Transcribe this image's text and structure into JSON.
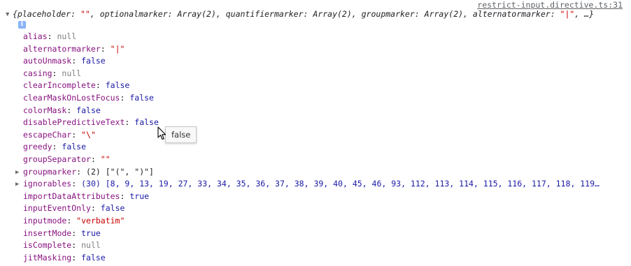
{
  "source_link": "restrict-input.directive.ts:31",
  "summary": {
    "open": "{",
    "items": [
      {
        "key": "placeholder",
        "value": "\"\"",
        "kind": "str"
      },
      {
        "key": "optionalmarker",
        "value": "Array(2)",
        "kind": "plain"
      },
      {
        "key": "quantifiermarker",
        "value": "Array(2)",
        "kind": "plain"
      },
      {
        "key": "groupmarker",
        "value": "Array(2)",
        "kind": "plain"
      },
      {
        "key": "alternatormarker",
        "value": "\"|\"",
        "kind": "str"
      }
    ],
    "tail": ", …}"
  },
  "info_icon": "i",
  "properties": [
    {
      "key": "alias",
      "value": "null",
      "kind": "null",
      "expandable": false
    },
    {
      "key": "alternatormarker",
      "value": "\"|\"",
      "kind": "str",
      "expandable": false
    },
    {
      "key": "autoUnmask",
      "value": "false",
      "kind": "bool",
      "expandable": false
    },
    {
      "key": "casing",
      "value": "null",
      "kind": "null",
      "expandable": false
    },
    {
      "key": "clearIncomplete",
      "value": "false",
      "kind": "bool",
      "expandable": false
    },
    {
      "key": "clearMaskOnLostFocus",
      "value": "false",
      "kind": "bool",
      "expandable": false
    },
    {
      "key": "colorMask",
      "value": "false",
      "kind": "bool",
      "expandable": false
    },
    {
      "key": "disablePredictiveText",
      "value": "false",
      "kind": "bool",
      "expandable": false
    },
    {
      "key": "escapeChar",
      "value": "\"\\\"",
      "kind": "str",
      "expandable": false
    },
    {
      "key": "greedy",
      "value": "false",
      "kind": "bool",
      "expandable": false
    },
    {
      "key": "groupSeparator",
      "value": "\"\"",
      "kind": "str",
      "expandable": false
    },
    {
      "key": "groupmarker",
      "value": "(2) [\"(\", \")\"]",
      "kind": "arr",
      "expandable": true
    },
    {
      "key": "ignorables",
      "value": "(30) [8, 9, 13, 19, 27, 33, 34, 35, 36, 37, 38, 39, 40, 45, 46, 93, 112, 113, 114, 115, 116, 117, 118, 119…",
      "kind": "arrnum",
      "expandable": true
    },
    {
      "key": "importDataAttributes",
      "value": "true",
      "kind": "bool",
      "expandable": false
    },
    {
      "key": "inputEventOnly",
      "value": "false",
      "kind": "bool",
      "expandable": false
    },
    {
      "key": "inputmode",
      "value": "\"verbatim\"",
      "kind": "str",
      "expandable": false
    },
    {
      "key": "insertMode",
      "value": "true",
      "kind": "bool",
      "expandable": false
    },
    {
      "key": "isComplete",
      "value": "null",
      "kind": "null",
      "expandable": false
    },
    {
      "key": "jitMasking",
      "value": "false",
      "kind": "bool",
      "expandable": false
    }
  ],
  "tooltip": "false",
  "colors": {
    "key": "#881280",
    "string": "#c80000",
    "keyword": "#1a1aa6",
    "null": "#808080"
  }
}
